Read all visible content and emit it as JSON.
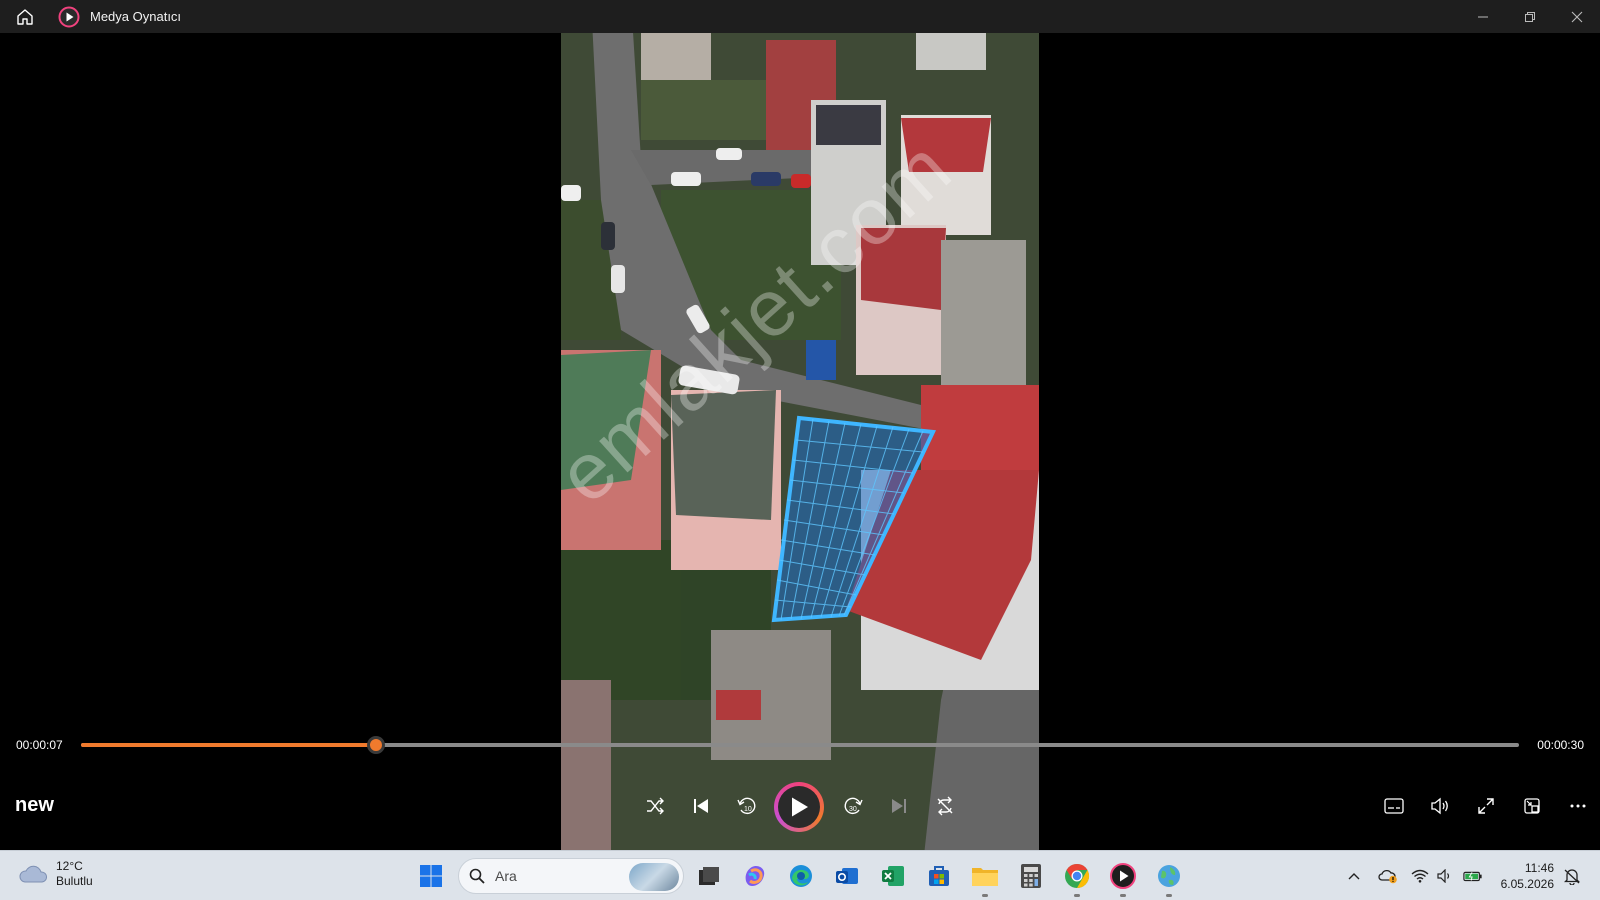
{
  "window": {
    "title": "Medya Oynatıcı"
  },
  "player": {
    "current_time": "00:00:07",
    "total_time": "00:00:30",
    "progress_fraction": 0.205,
    "media_title": "new"
  },
  "video": {
    "watermark": "emlakjet.com"
  },
  "taskbar": {
    "weather_temp": "12°C",
    "weather_desc": "Bulutlu",
    "search_placeholder": "Ara",
    "apps": [
      "start-icon",
      "task-view-icon",
      "copilot-icon",
      "edge-icon",
      "outlook-icon",
      "excel-icon",
      "store-icon",
      "file-explorer-icon",
      "calculator-icon",
      "chrome-icon",
      "media-player-icon",
      "globe-app-icon"
    ],
    "time": "11:46",
    "date": "6.05.2026"
  },
  "colors": {
    "accent": "#f07a2d",
    "titlebar": "#1e1e1e",
    "taskbar": "#dde3ea"
  }
}
